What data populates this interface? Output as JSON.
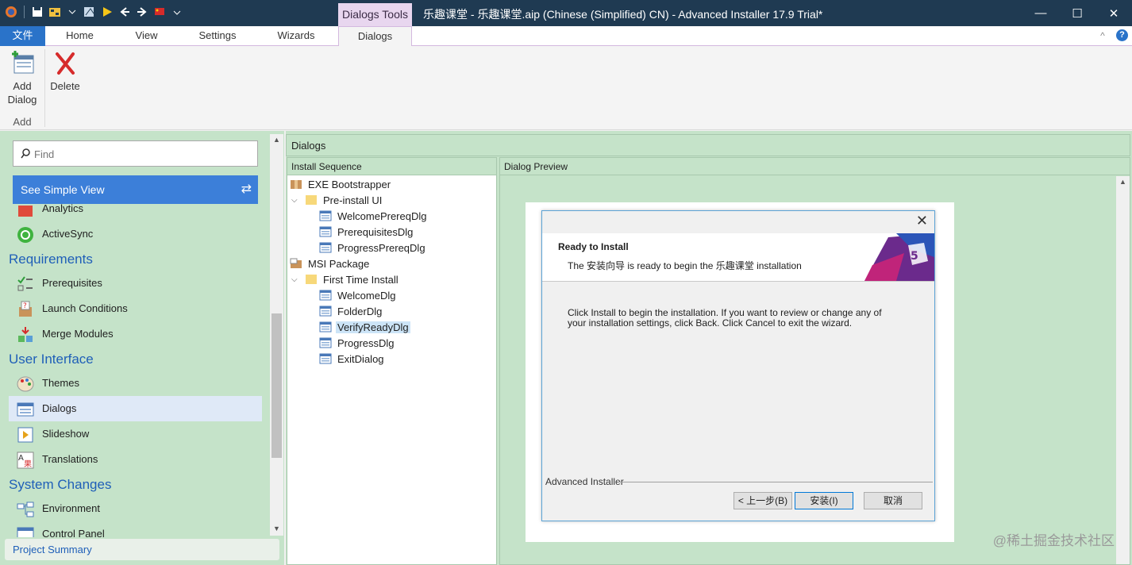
{
  "titlebar": {
    "context_tab": "Dialogs Tools",
    "title": "乐趣课堂 - 乐趣课堂.aip (Chinese (Simplified) CN) - Advanced Installer 17.9 Trial*",
    "minimize": "—",
    "maximize": "☐",
    "close": "✕"
  },
  "ribbon_tabs": [
    "文件",
    "Home",
    "View",
    "Settings",
    "Wizards",
    "Dialogs"
  ],
  "ribbon": {
    "add_dialog_label_1": "Add",
    "add_dialog_label_2": "Dialog",
    "delete_label": "Delete",
    "group_label": "Add",
    "collapse": "^",
    "help": "?"
  },
  "left": {
    "find_placeholder": "Find",
    "simple_view": "See Simple View",
    "items": {
      "analytics": "Analytics",
      "activesync": "ActiveSync",
      "requirements_head": "Requirements",
      "prerequisites": "Prerequisites",
      "launch_conditions": "Launch Conditions",
      "merge_modules": "Merge Modules",
      "ui_head": "User Interface",
      "themes": "Themes",
      "dialogs": "Dialogs",
      "slideshow": "Slideshow",
      "translations": "Translations",
      "system_head": "System Changes",
      "environment": "Environment",
      "control_panel": "Control Panel"
    },
    "summary": "Project Summary"
  },
  "main": {
    "header": "Dialogs",
    "sequence_header": "Install Sequence",
    "preview_header": "Dialog Preview",
    "tree": {
      "exe": "EXE Bootstrapper",
      "preinstall": "Pre-install UI",
      "welcome_prereq": "WelcomePrereqDlg",
      "prerequisites": "PrerequisitesDlg",
      "progress_prereq": "ProgressPrereqDlg",
      "msi": "MSI Package",
      "first_time": "First Time Install",
      "welcome": "WelcomeDlg",
      "folder": "FolderDlg",
      "verify": "VerifyReadyDlg",
      "progress": "ProgressDlg",
      "exit": "ExitDialog"
    }
  },
  "dialog": {
    "title": "Ready to Install",
    "subtitle": "The 安装向导 is ready to begin the 乐趣课堂 installation",
    "body": "Click Install to begin the installation. If you want to review or change any of your installation settings, click Back. Click Cancel to exit the wizard.",
    "brand": "Advanced Installer",
    "back": "< 上一步(B)",
    "install": "安装(I)",
    "cancel": "取消"
  },
  "watermark": "@稀土掘金技术社区"
}
